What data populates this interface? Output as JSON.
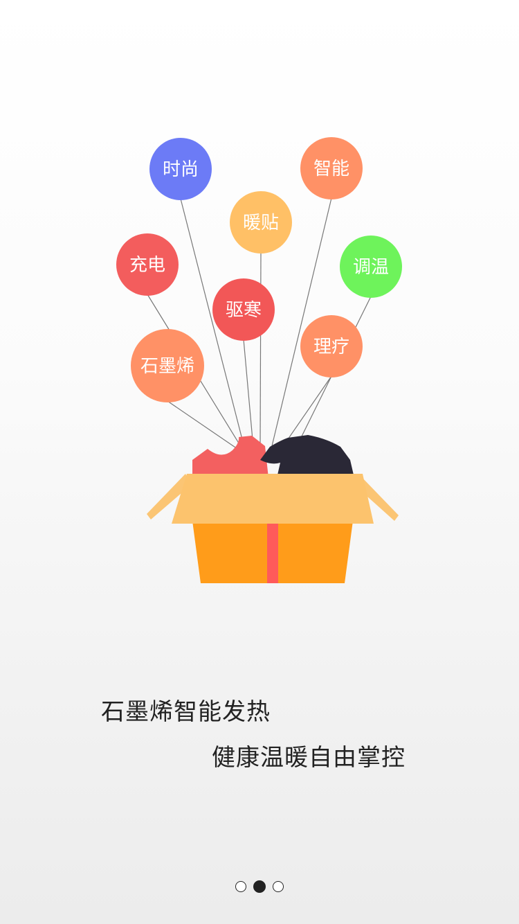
{
  "illustration": {
    "balloons": [
      {
        "label": "时尚",
        "color": "#6C7BF6"
      },
      {
        "label": "智能",
        "color": "#FF9166"
      },
      {
        "label": "暖贴",
        "color": "#FFC066"
      },
      {
        "label": "充电",
        "color": "#F35D5D"
      },
      {
        "label": "调温",
        "color": "#6EF35B"
      },
      {
        "label": "驱寒",
        "color": "#F25757"
      },
      {
        "label": "理疗",
        "color": "#FF9166"
      },
      {
        "label": "石墨烯",
        "color": "#FF9166"
      }
    ],
    "box_color": "#FF9C1A",
    "box_lid_color": "#FCC36D",
    "ribbon_color": "#FF5A5A",
    "red_shirt_color": "#F36060",
    "dark_shirt_color": "#2A2836"
  },
  "tagline": {
    "line1": "石墨烯智能发热",
    "line2": "健康温暖自由掌控"
  },
  "pager": {
    "pages": 3,
    "active_index": 1
  }
}
